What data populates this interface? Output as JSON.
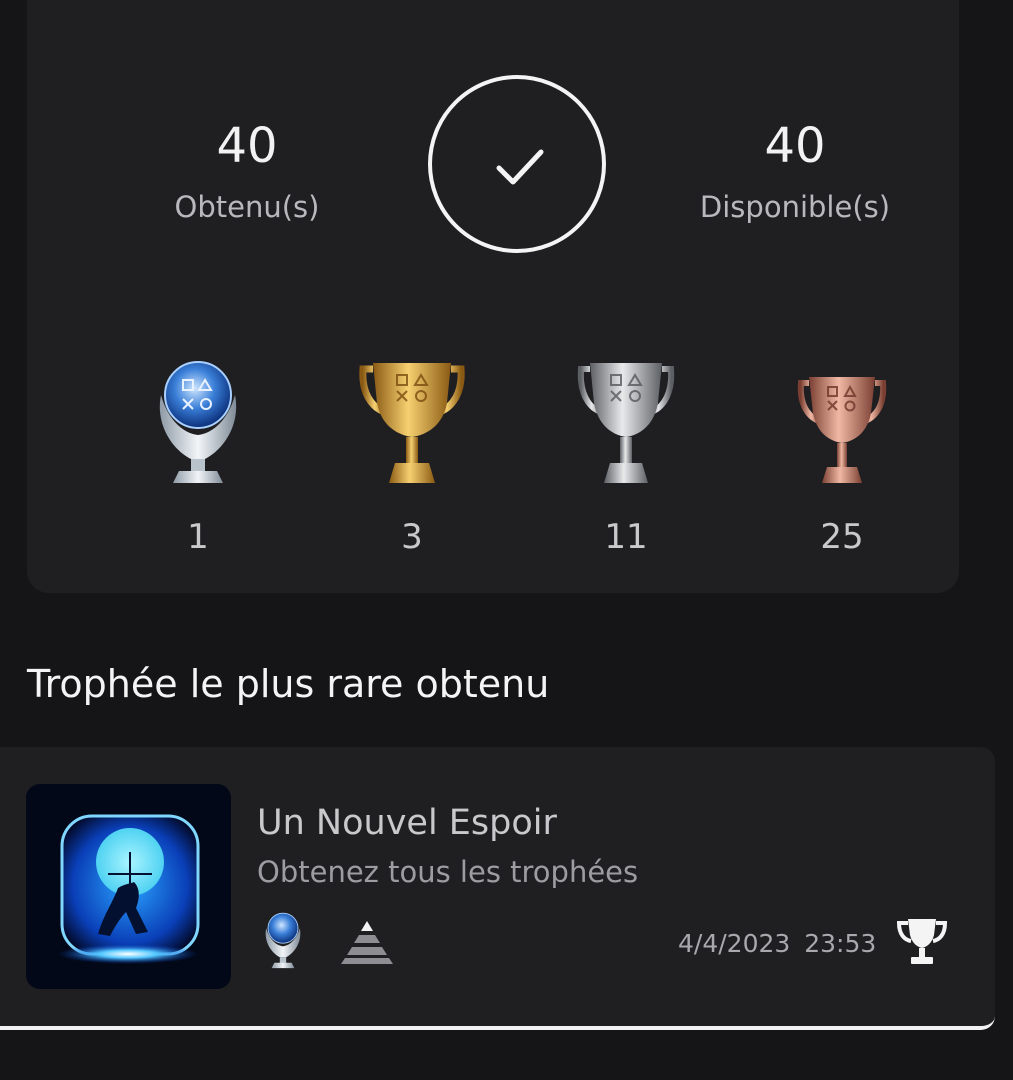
{
  "summary": {
    "earned_count": "40",
    "earned_label": "Obtenu(s)",
    "available_count": "40",
    "available_label": "Disponible(s)",
    "completed_icon": "checkmark-icon"
  },
  "trophies": [
    {
      "grade": "platinum",
      "icon": "platinum-trophy-icon",
      "count": "1"
    },
    {
      "grade": "gold",
      "icon": "gold-trophy-icon",
      "count": "3"
    },
    {
      "grade": "silver",
      "icon": "silver-trophy-icon",
      "count": "11"
    },
    {
      "grade": "bronze",
      "icon": "bronze-trophy-icon",
      "count": "25"
    }
  ],
  "rarest": {
    "section_title": "Trophée le plus rare obtenu",
    "name": "Un Nouvel Espoir",
    "description": "Obtenez tous les trophées",
    "date": "4/4/2023  23:53",
    "grade_icon": "platinum-trophy-icon",
    "rarity_icon": "rarity-pyramid-icon",
    "action_icon": "trophy-icon"
  },
  "colors": {
    "background": "#151518",
    "card": "#1f1f22",
    "platinum": "#7fb2e6",
    "gold": "#d9a63a",
    "silver": "#b8b8bc",
    "bronze": "#c98a78"
  }
}
